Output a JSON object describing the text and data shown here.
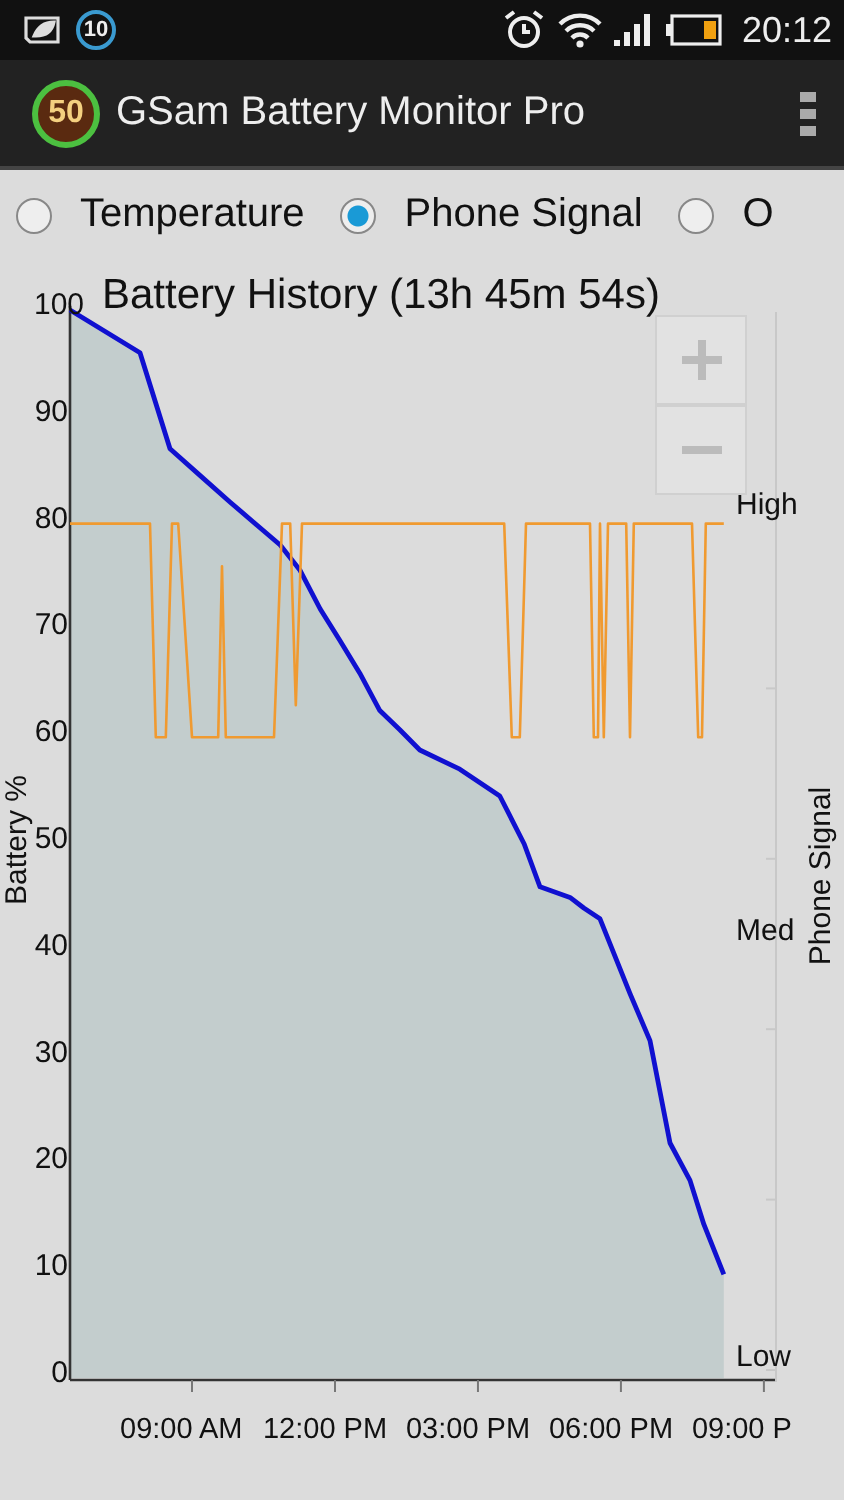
{
  "status_bar": {
    "notification_count": "10",
    "time": "20:12"
  },
  "app_bar": {
    "logo_text": "50",
    "title": "GSam Battery Monitor Pro"
  },
  "radio_options": [
    {
      "label": "Temperature",
      "selected": false
    },
    {
      "label": "Phone Signal",
      "selected": true
    },
    {
      "label": "O",
      "selected": false
    }
  ],
  "chart": {
    "chart_data": {
      "type": "area",
      "title": "Battery History (13h 45m 54s)",
      "ylabel": "Battery %",
      "y2label": "Phone Signal",
      "xlim": [
        6.44,
        21.17
      ],
      "ylim": [
        0,
        100
      ],
      "xticks": [
        {
          "value": 9,
          "label": "09:00 AM"
        },
        {
          "value": 12,
          "label": "12:00 PM"
        },
        {
          "value": 15,
          "label": "03:00 PM"
        },
        {
          "value": 18,
          "label": "06:00 PM"
        },
        {
          "value": 21,
          "label": "09:00 P"
        }
      ],
      "yticks": [
        0,
        10,
        20,
        30,
        40,
        50,
        60,
        70,
        80,
        90,
        100
      ],
      "series": [
        {
          "color": "#1010d0",
          "x": [
            6.44,
            7.91,
            8.12,
            8.54,
            9.17,
            9.8,
            10.85,
            11.27,
            11.69,
            12.11,
            12.52,
            12.94,
            13.36,
            13.78,
            14.62,
            15.46,
            15.97,
            16.3,
            16.93,
            17.22,
            17.56,
            18.19,
            18.61,
            19.03,
            19.45,
            19.74,
            20.16
          ],
          "values": [
            100,
            96,
            93,
            87,
            84.5,
            82,
            78,
            75.6,
            72,
            69,
            66,
            62.5,
            60.7,
            58.8,
            57,
            54.5,
            50,
            46,
            45,
            44,
            43,
            36,
            31.6,
            22,
            18.5,
            14.4,
            9.7
          ]
        },
        {
          "color": "#f09a30",
          "type": "line",
          "x": [
            6.44,
            8.12,
            8.24,
            8.45,
            8.58,
            8.71,
            9.0,
            9.55,
            9.63,
            9.71,
            10.72,
            10.89,
            11.06,
            11.18,
            11.31,
            15.55,
            15.71,
            15.88,
            16.01,
            17.35,
            17.43,
            17.52,
            17.56,
            17.64,
            17.73,
            18.11,
            18.19,
            18.27,
            19.49,
            19.62,
            19.7,
            19.78,
            20.16
          ],
          "values": [
            80,
            80,
            60,
            60,
            80,
            80,
            60,
            60,
            76,
            60,
            60,
            80,
            80,
            63,
            80,
            80,
            60,
            60,
            80,
            80,
            60,
            60,
            80,
            60,
            80,
            80,
            60,
            80,
            80,
            60,
            60,
            80,
            80
          ]
        }
      ]
    },
    "signal_levels": [
      "High",
      "Med",
      "Low"
    ]
  }
}
